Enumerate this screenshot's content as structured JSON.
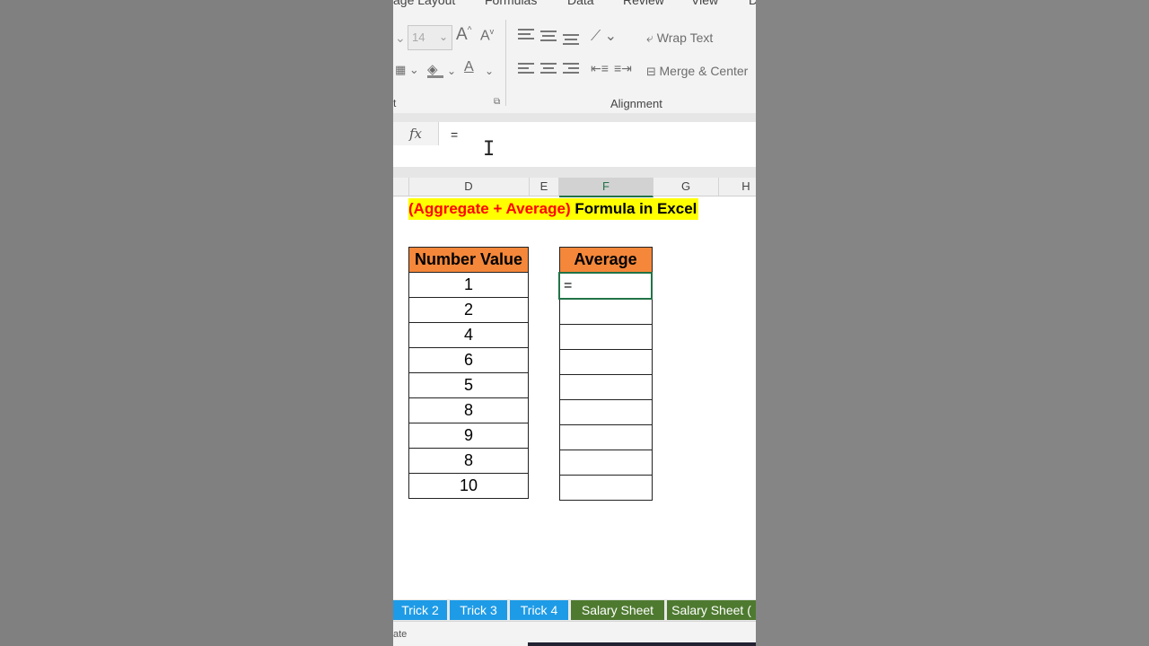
{
  "menu": [
    "age Layout",
    "Formulas",
    "Data",
    "Review",
    "View",
    "D"
  ],
  "ribbon": {
    "font_size": "14",
    "grow_font": "A",
    "shrink_font": "A",
    "wrap_text": "Wrap Text",
    "merge_center": "Merge & Center",
    "alignment_label": "Alignment",
    "font_group_label_fragment": "t",
    "font_color_label": "A"
  },
  "formula_bar": {
    "fx": "fx",
    "content": "="
  },
  "columns": [
    "D",
    "E",
    "F",
    "G",
    "H"
  ],
  "title": {
    "red_part": "(Aggregate + Average)",
    "black_part": "Formula in Excel"
  },
  "table_values": {
    "header": "Number Value",
    "values": [
      "1",
      "2",
      "4",
      "6",
      "5",
      "8",
      "9",
      "8",
      "10"
    ]
  },
  "table_average": {
    "header": "Average",
    "active_cell": "="
  },
  "tabs": [
    {
      "label": "Trick 2",
      "color": "#1e9be6"
    },
    {
      "label": "Trick 3",
      "color": "#1e9be6"
    },
    {
      "label": "Trick 4",
      "color": "#1e9be6"
    },
    {
      "label": "Salary Sheet",
      "color": "#4e7a30"
    },
    {
      "label": "Salary Sheet (",
      "color": "#4e7a30"
    }
  ],
  "status": "ate",
  "colors": {
    "accent": "#217346",
    "header_fill": "#f4873a",
    "title_fill": "#ffff00"
  }
}
